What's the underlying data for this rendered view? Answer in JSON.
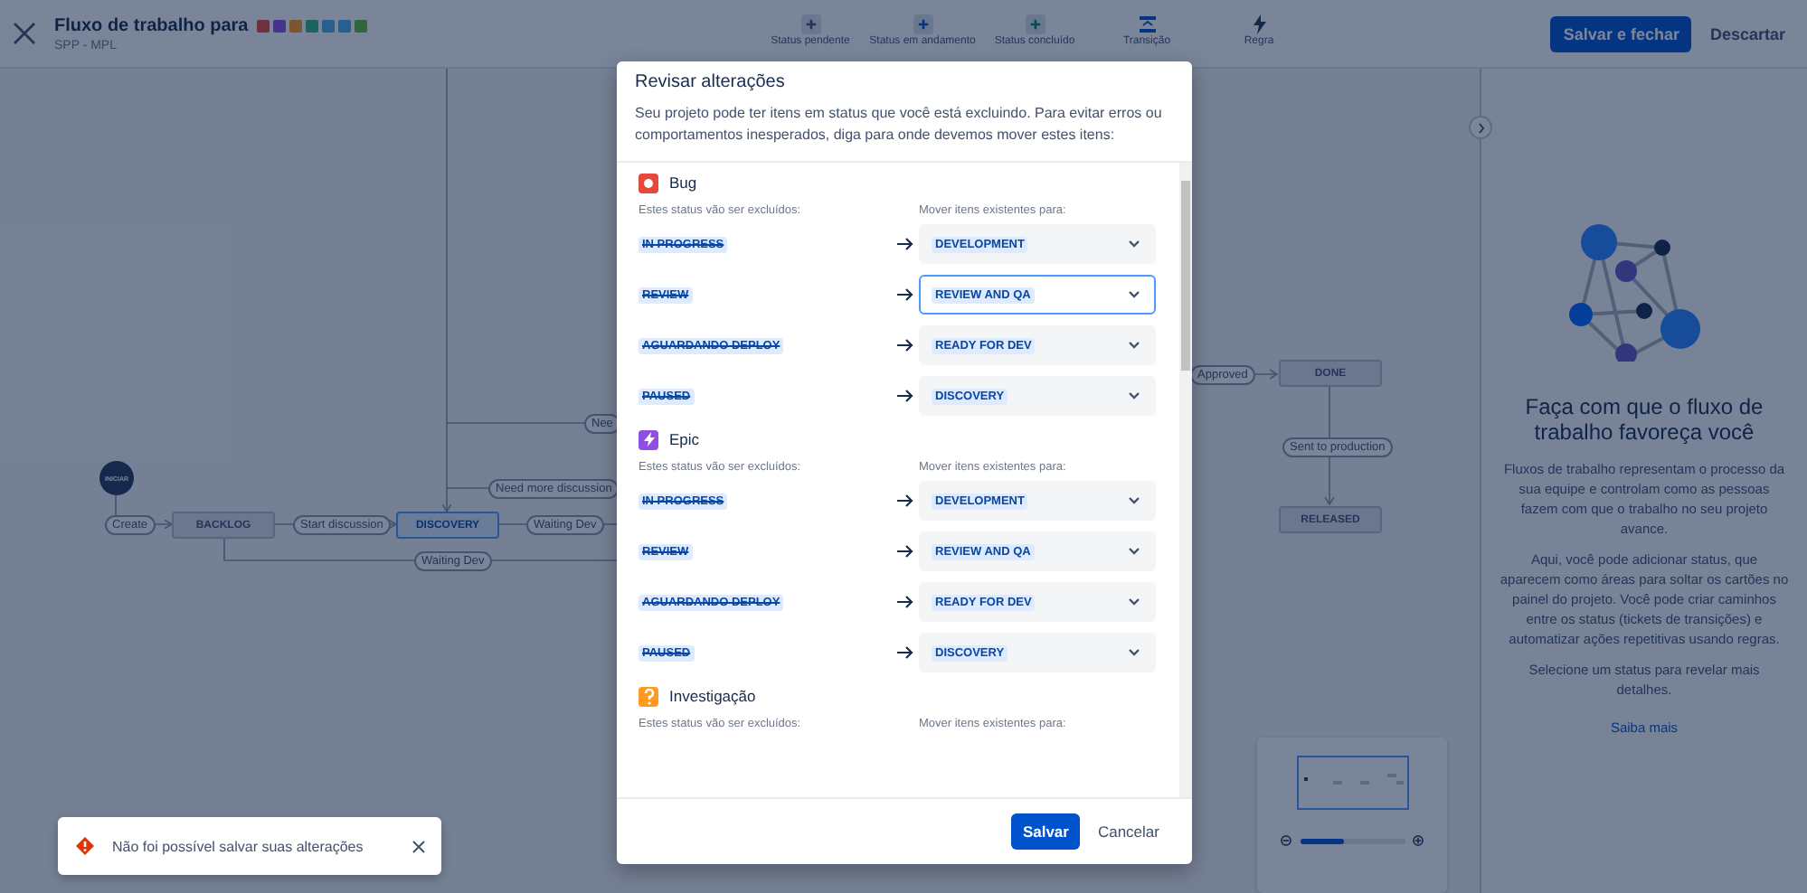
{
  "header": {
    "title": "Fluxo de trabalho para",
    "subtitle": "SPP - MPL",
    "tools": [
      {
        "kind": "todo",
        "label": "Status pendente"
      },
      {
        "kind": "progress",
        "label": "Status em andamento"
      },
      {
        "kind": "done",
        "label": "Status concluído"
      },
      {
        "kind": "transition",
        "label": "Transição"
      },
      {
        "kind": "rule",
        "label": "Regra"
      }
    ],
    "primary_button": "Salvar e fechar",
    "secondary_button": "Descartar"
  },
  "diagram": {
    "nodes": [
      {
        "kind": "start",
        "label": "INICIAR"
      },
      {
        "kind": "transition",
        "label": "Create",
        "selected": false
      },
      {
        "kind": "status",
        "label": "BACKLOG",
        "selected": false
      },
      {
        "kind": "transition",
        "label": "Start discussion",
        "selected": false
      },
      {
        "kind": "status",
        "label": "DISCOVERY",
        "selected": true
      },
      {
        "kind": "transition",
        "label": "Nee",
        "selected": false
      },
      {
        "kind": "transition",
        "label": "Need more discussion",
        "selected": false
      },
      {
        "kind": "transition",
        "label": "Waiting Dev",
        "selected": false
      },
      {
        "kind": "transition",
        "label": "Waiting Dev",
        "selected": false
      },
      {
        "kind": "transition",
        "label": "Approved",
        "selected": false
      },
      {
        "kind": "status",
        "label": "DONE",
        "selected": false
      },
      {
        "kind": "transition",
        "label": "Sent to production",
        "selected": false
      },
      {
        "kind": "status",
        "label": "RELEASED",
        "selected": false
      }
    ],
    "zoom": {
      "level": 0.42
    }
  },
  "panel": {
    "title": "Faça com que o fluxo de trabalho favoreça você",
    "paragraphs": [
      "Fluxos de trabalho representam o processo da sua equipe e controlam como as pessoas fazem com que o trabalho no seu projeto avance.",
      "Aqui, você pode adicionar status, que aparecem como áreas para soltar os cartões no painel do projeto. Você pode criar caminhos entre os status (tickets de transições) e automatizar ações repetitivas usando regras.",
      "Selecione um status para revelar mais detalhes."
    ],
    "link": "Saiba mais"
  },
  "modal": {
    "title": "Revisar alterações",
    "description": "Seu projeto pode ter itens em status que você está excluindo. Para evitar erros ou comportamentos inesperados, diga para onde devemos mover estes itens:",
    "groups": [
      {
        "kind": "bug",
        "name": "Bug",
        "from_label": "Estes status vão ser excluídos:",
        "to_label": "Mover itens existentes para:",
        "rows": [
          {
            "from": "IN PROGRESS",
            "to": "DEVELOPMENT",
            "focused": false
          },
          {
            "from": "REVIEW",
            "to": "REVIEW AND QA",
            "focused": true
          },
          {
            "from": "AGUARDANDO DEPLOY",
            "to": "READY FOR DEV",
            "focused": false
          },
          {
            "from": "PAUSED",
            "to": "DISCOVERY",
            "focused": false
          }
        ]
      },
      {
        "kind": "epic",
        "name": "Epic",
        "from_label": "Estes status vão ser excluídos:",
        "to_label": "Mover itens existentes para:",
        "rows": [
          {
            "from": "IN PROGRESS",
            "to": "DEVELOPMENT",
            "focused": false
          },
          {
            "from": "REVIEW",
            "to": "REVIEW AND QA",
            "focused": false
          },
          {
            "from": "AGUARDANDO DEPLOY",
            "to": "READY FOR DEV",
            "focused": false
          },
          {
            "from": "PAUSED",
            "to": "DISCOVERY",
            "focused": false
          }
        ]
      },
      {
        "kind": "question",
        "name": "Investigação",
        "from_label": "Estes status vão ser excluídos:",
        "to_label": "Mover itens existentes para:"
      }
    ],
    "save_button": "Salvar",
    "cancel_button": "Cancelar"
  },
  "toast": {
    "message": "Não foi possível salvar suas alterações"
  }
}
